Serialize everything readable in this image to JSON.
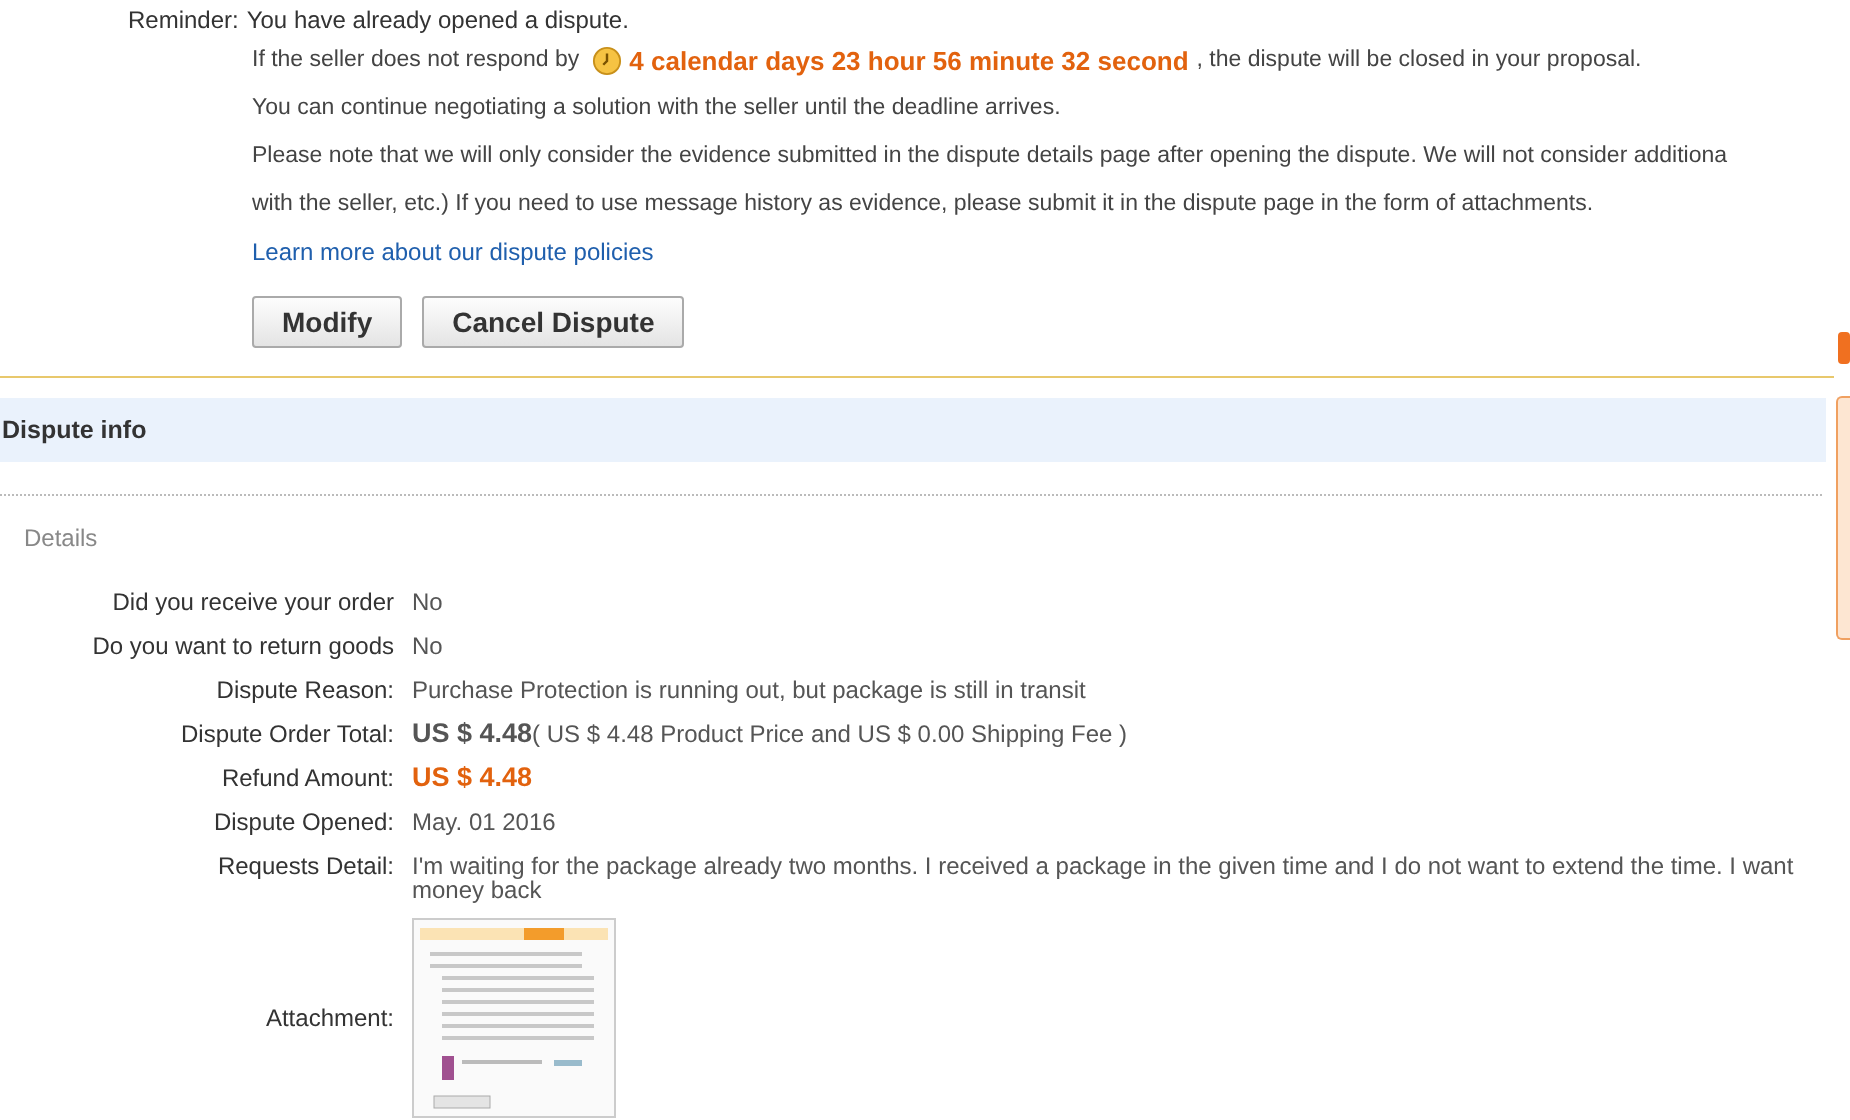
{
  "reminder": {
    "label": "Reminder:",
    "text": "You have already opened a dispute.",
    "deadline_before": "If the seller does not respond by",
    "countdown": "4 calendar days 23 hour 56 minute 32 second",
    "deadline_after": ", the dispute will be closed in your proposal.",
    "lines": [
      "You can continue negotiating a solution with the seller until the deadline arrives.",
      "Please note that we will only consider the evidence submitted in the dispute details page after opening the dispute. We will not consider additiona",
      "with the seller, etc.) If you need to use message history as evidence, please submit it in the dispute page in the form of attachments."
    ],
    "link": "Learn more about our dispute policies",
    "buttons": [
      "Modify",
      "Cancel Dispute"
    ]
  },
  "section": {
    "title": "Dispute info",
    "subtitle": "Details"
  },
  "details": [
    {
      "kind": "text",
      "label": "Did you receive your order",
      "value": "No"
    },
    {
      "kind": "text",
      "label": "Do you want to return goods",
      "value": "No"
    },
    {
      "kind": "text",
      "label": "Dispute Reason:",
      "value": "Purchase Protection is running out, but package is still in transit"
    },
    {
      "kind": "total",
      "label": "Dispute Order Total:",
      "amount": "US $ 4.48",
      "value": "( US $ 4.48 Product Price and US $ 0.00 Shipping Fee )"
    },
    {
      "kind": "refund",
      "label": "Refund Amount:",
      "amount": "US $ 4.48"
    },
    {
      "kind": "text",
      "label": "Dispute Opened:",
      "value": "May. 01 2016"
    },
    {
      "kind": "text",
      "label": "Requests Detail:",
      "value": "I'm waiting for the package already two months. I received a package in the given time and I do not want to extend the time. I want money back"
    },
    {
      "kind": "attachment",
      "label": "Attachment:"
    }
  ]
}
